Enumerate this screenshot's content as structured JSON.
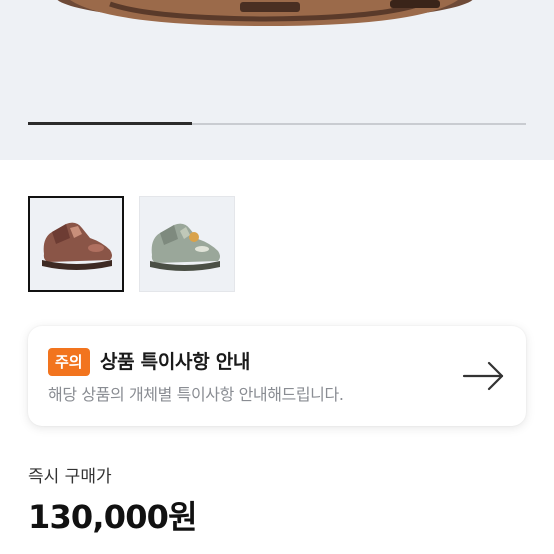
{
  "gallery": {
    "progress": 0.33,
    "thumbnails": [
      {
        "name": "brown-sneaker",
        "selected": true
      },
      {
        "name": "grey-sneaker",
        "selected": false
      }
    ]
  },
  "notice": {
    "badge": "주의",
    "title": "상품 특이사항 안내",
    "description": "해당 상품의 개체별 특이사항 안내해드립니다.",
    "arrow_icon": "arrow-right-icon",
    "badge_color": "#f2741e"
  },
  "price": {
    "label": "즉시 구매가",
    "value": "130,000원"
  }
}
